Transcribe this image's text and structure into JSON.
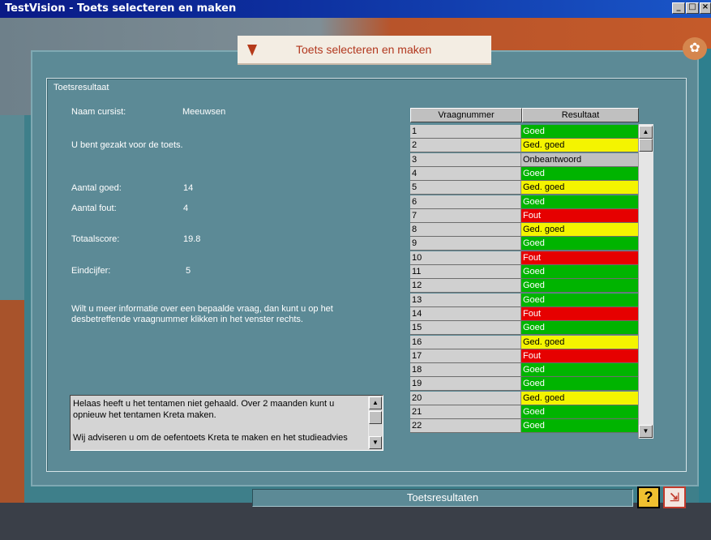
{
  "window": {
    "title": "TestVision - Toets selecteren en maken"
  },
  "header": {
    "title": "Toets selecteren en maken"
  },
  "group": {
    "legend": "Toetsresultaat"
  },
  "summary": {
    "name_label": "Naam cursist:",
    "name_value": "Meeuwsen",
    "result_text": "U bent gezakt voor de toets.",
    "correct_label": "Aantal goed:",
    "correct_value": "14",
    "wrong_label": "Aantal fout:",
    "wrong_value": "4",
    "score_label": "Totaalscore:",
    "score_value": "19.8",
    "grade_label": "Eindcijfer:",
    "grade_value": "5",
    "info_line1": "Wilt u meer informatie over een bepaalde vraag, dan kunt u op het",
    "info_line2": "desbetreffende vraagnummer klikken in het venster rechts."
  },
  "message": {
    "line1": "Helaas heeft u het tentamen niet gehaald. Over 2 maanden kunt u",
    "line2": "opnieuw het tentamen Kreta maken.",
    "line3": "Wij adviseren u om de oefentoets Kreta te maken en het studieadvies"
  },
  "table": {
    "headers": [
      "Vraagnummer",
      "Resultaat"
    ],
    "rows": [
      {
        "num": "1",
        "result": "Goed"
      },
      {
        "num": "2",
        "result": "Ged. goed"
      },
      {
        "num": "3",
        "result": "Onbeantwoord"
      },
      {
        "num": "4",
        "result": "Goed"
      },
      {
        "num": "5",
        "result": "Ged. goed"
      },
      {
        "num": "6",
        "result": "Goed"
      },
      {
        "num": "7",
        "result": "Fout"
      },
      {
        "num": "8",
        "result": "Ged. goed"
      },
      {
        "num": "9",
        "result": "Goed"
      },
      {
        "num": "10",
        "result": "Fout"
      },
      {
        "num": "11",
        "result": "Goed"
      },
      {
        "num": "12",
        "result": "Goed"
      },
      {
        "num": "13",
        "result": "Goed"
      },
      {
        "num": "14",
        "result": "Fout"
      },
      {
        "num": "15",
        "result": "Goed"
      },
      {
        "num": "16",
        "result": "Ged. goed"
      },
      {
        "num": "17",
        "result": "Fout"
      },
      {
        "num": "18",
        "result": "Goed"
      },
      {
        "num": "19",
        "result": "Goed"
      },
      {
        "num": "20",
        "result": "Ged. goed"
      },
      {
        "num": "21",
        "result": "Goed"
      },
      {
        "num": "22",
        "result": "Goed"
      }
    ]
  },
  "status_colors": {
    "Goed": "#00b400",
    "Ged. goed": "#f4f400",
    "Onbeantwoord": "#c0c0c0",
    "Fout": "#e60000"
  },
  "footer": {
    "status": "Toetsresultaten",
    "help_icon": "question-icon",
    "exit_icon": "exit-icon"
  }
}
